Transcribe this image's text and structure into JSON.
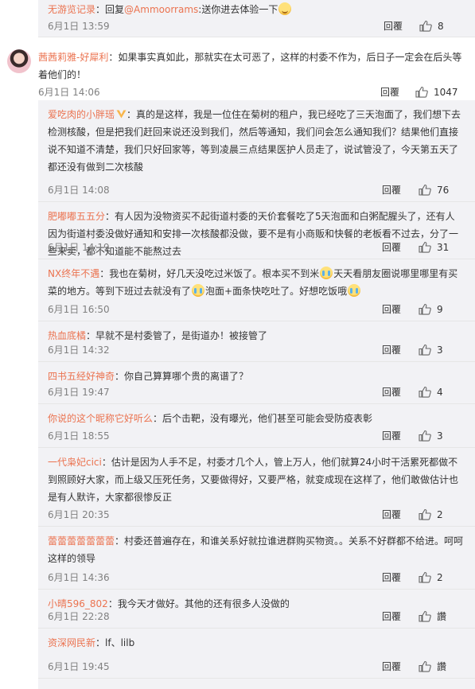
{
  "actions": {
    "reply_label": "回覆"
  },
  "top_reply": {
    "username": "无游览记录",
    "text_reply": "回复",
    "mention": "@Ammoorrams",
    "text_body": ":送你进去体验一下",
    "emoji": "smile-emoji",
    "time": "6月1日 13:59",
    "likes": "8"
  },
  "main_comment": {
    "avatar": "avatar",
    "username": "茜茜莉雅-好犀利",
    "text": "如果事实真如此，那就实在太可恶了，这样的村委不作为，后日子一定会在后头等着他们的！",
    "time": "6月1日 14:06",
    "likes": "1047"
  },
  "sub_comments": [
    {
      "username": "爱吃肉的小胖瑶",
      "verified_badge": "v-badge-icon",
      "segments": [
        {
          "t": "：真的是这样，我是一位住在菊树的租户，我已经吃了三天泡面了，我们想下去检测核酸，但是把我们赶回来说还没到我们，然后等通知，我们问会怎么通知我们？结果他们直接说不知道不清楚，我们只好回家等，等到凌晨三点结果医护人员走了，说试管没了，今天第五天了都还没有做到二次核酸"
        }
      ],
      "time": "6月1日 14:08",
      "likes": "76"
    },
    {
      "username": "肥嘟嘟五五分",
      "segments": [
        {
          "t": "：有人因为没物资买不起街道村委的天价套餐吃了5天泡面和白粥配腥头了，还有人因为街道村委没做好通知和安排一次核酸都没做，要不是有小商贩和快餐的老板看不过去，分了一些来卖，都不知道能不能熬过去"
        }
      ],
      "time": "6月1日 14:19",
      "likes": "31"
    },
    {
      "username": "NX终年不遇",
      "segments": [
        {
          "t": "：我也在菊树，好几天没吃过米饭了。根本买不到米"
        },
        {
          "emoji": "cry-emoji"
        },
        {
          "t": "天天看朋友圈说哪里哪里有买菜的地方。等到下班过去就没有了"
        },
        {
          "emoji": "cry-emoji"
        },
        {
          "t": "泡面+面条快吃吐了。好想吃饭哦"
        },
        {
          "emoji": "cry-emoji"
        }
      ],
      "time": "6月1日 16:50",
      "likes": "9"
    },
    {
      "username": "热血底橘",
      "segments": [
        {
          "t": "：早就不是村委管了，是街道办！被接管了"
        }
      ],
      "time": "6月1日 14:32",
      "likes": "3"
    },
    {
      "username": "四书五经好神奇",
      "segments": [
        {
          "t": "：你自己算算哪个贵的离谱了？"
        }
      ],
      "time": "6月1日 19:47",
      "likes": "4"
    },
    {
      "username": "你说的这个昵称它好听么",
      "segments": [
        {
          "t": "：后个击靶，没有曝光，他们甚至可能会受防疫表彰"
        }
      ],
      "time": "6月1日 18:55",
      "likes": "3"
    },
    {
      "username": "一代枭妃cici",
      "segments": [
        {
          "t": "：估计是因为人手不足，村委才几个人，管上万人，他们就算24小时干活累死都做不到照顾好大家，而上级又压死任务，又要做得好，又要严格，就变成现在这样了，他们敢做估计也是有人默许，大家都很惨反正"
        }
      ],
      "time": "6月1日 20:35",
      "likes": "2"
    },
    {
      "username": "蕾蕾蕾蕾蕾蕾蕾",
      "segments": [
        {
          "t": "：村委还普遍存在，和谁关系好就拉谁进群购买物资。。关系不好群都不给进。呵呵这样的领导"
        }
      ],
      "time": "6月1日 14:36",
      "likes": "2"
    },
    {
      "username": "小晴596_802",
      "segments": [
        {
          "t": "：我今天才做好。其他的还有很多人没做的"
        }
      ],
      "time": "6月1日 22:28",
      "likes": "讚"
    },
    {
      "username": "资深网民新",
      "segments": [
        {
          "t": "：lf、lilb"
        }
      ],
      "time": "6月1日 19:45",
      "likes": "讚"
    }
  ]
}
